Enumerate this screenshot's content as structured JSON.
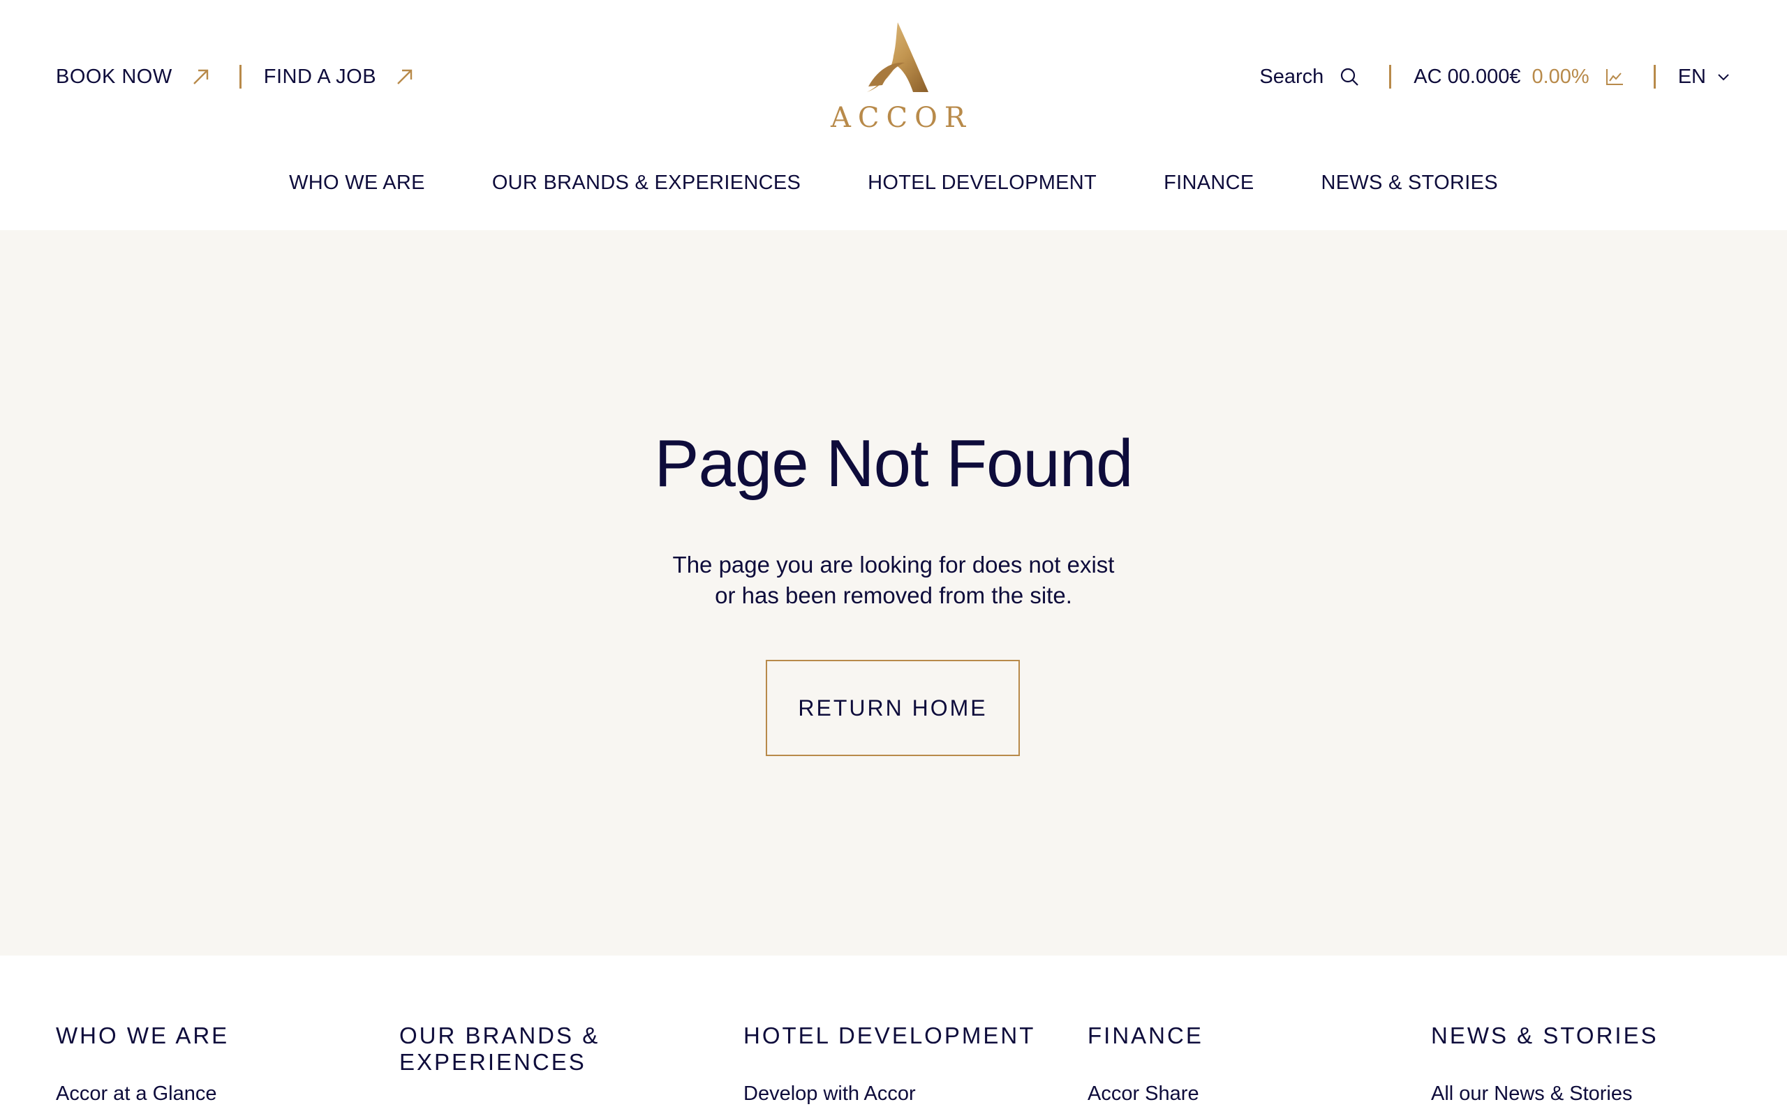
{
  "header": {
    "book_now": "BOOK NOW",
    "find_a_job": "FIND A JOB",
    "logo_text": "ACCOR",
    "search_label": "Search",
    "stock_ticker": "AC 00.000€",
    "stock_change": "0.00%",
    "language": "EN"
  },
  "nav": {
    "items": [
      "WHO WE ARE",
      "OUR BRANDS & EXPERIENCES",
      "HOTEL DEVELOPMENT",
      "FINANCE",
      "NEWS & STORIES"
    ]
  },
  "hero": {
    "title": "Page Not Found",
    "subtitle_line1": "The page you are looking for does not exist",
    "subtitle_line2": "or has been removed from the site.",
    "button": "RETURN HOME"
  },
  "footer": {
    "columns": [
      {
        "heading": "WHO WE ARE",
        "first_link": "Accor at a Glance"
      },
      {
        "heading": "OUR BRANDS & EXPERIENCES",
        "first_link": ""
      },
      {
        "heading": "HOTEL DEVELOPMENT",
        "first_link": "Develop with Accor"
      },
      {
        "heading": "FINANCE",
        "first_link": "Accor Share"
      },
      {
        "heading": "NEWS & STORIES",
        "first_link": "All our News & Stories"
      }
    ]
  },
  "colors": {
    "navy": "#0e0c3b",
    "gold": "#b88a4a",
    "hero_background": "#f8f6f2"
  },
  "icons": [
    "arrow-up-right-icon",
    "search-icon",
    "stock-chart-icon",
    "chevron-down-icon"
  ]
}
